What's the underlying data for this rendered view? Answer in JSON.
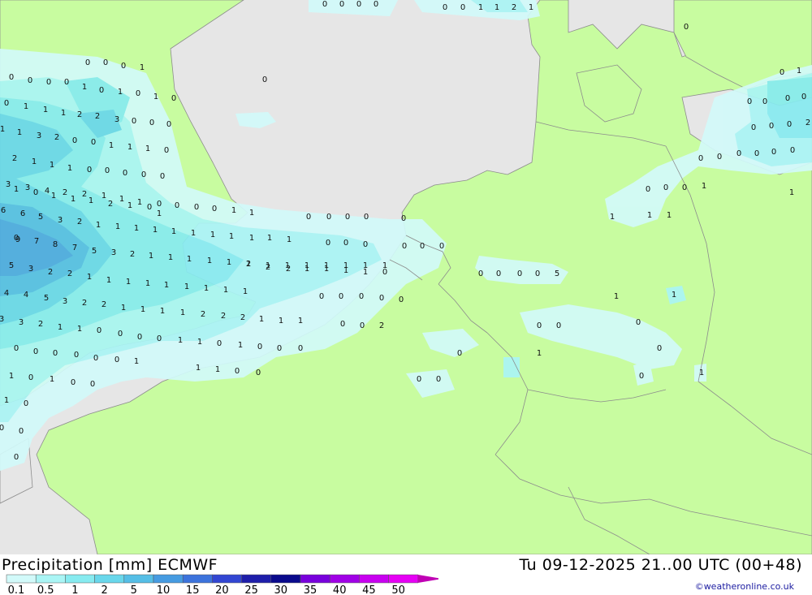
{
  "map": {
    "colors": {
      "sea": "#e6e6e6",
      "land": "#c8fca0",
      "border": "#8c8c8c"
    },
    "values": [
      {
        "t": "0"
      },
      {
        "t": "0"
      },
      {
        "t": "0"
      },
      {
        "t": "0"
      },
      {
        "t": "0"
      },
      {
        "t": "0"
      },
      {
        "t": "1"
      },
      {
        "t": "1"
      },
      {
        "t": "2"
      },
      {
        "t": "1"
      },
      {
        "t": "0"
      },
      {
        "t": "0"
      },
      {
        "t": "0"
      },
      {
        "t": "0"
      },
      {
        "t": "1"
      },
      {
        "t": "0"
      },
      {
        "t": "0"
      },
      {
        "t": "0"
      },
      {
        "t": "0"
      },
      {
        "t": "0"
      },
      {
        "t": "1"
      },
      {
        "t": "0"
      },
      {
        "t": "1"
      },
      {
        "t": "0"
      },
      {
        "t": "1"
      },
      {
        "t": "0"
      },
      {
        "t": "0"
      },
      {
        "t": "1"
      },
      {
        "t": "1"
      },
      {
        "t": "1"
      },
      {
        "t": "2"
      },
      {
        "t": "2"
      },
      {
        "t": "3"
      },
      {
        "t": "0"
      },
      {
        "t": "0"
      },
      {
        "t": "0"
      },
      {
        "t": "1"
      },
      {
        "t": "1"
      },
      {
        "t": "3"
      },
      {
        "t": "2"
      },
      {
        "t": "0"
      },
      {
        "t": "0"
      },
      {
        "t": "1"
      },
      {
        "t": "1"
      },
      {
        "t": "1"
      },
      {
        "t": "0"
      },
      {
        "t": "2"
      },
      {
        "t": "1"
      },
      {
        "t": "1"
      },
      {
        "t": "1"
      },
      {
        "t": "0"
      },
      {
        "t": "0"
      },
      {
        "t": "0"
      },
      {
        "t": "0"
      },
      {
        "t": "0"
      },
      {
        "t": "3"
      },
      {
        "t": "3"
      },
      {
        "t": "4"
      },
      {
        "t": "2"
      },
      {
        "t": "2"
      },
      {
        "t": "1"
      },
      {
        "t": "1"
      },
      {
        "t": "1"
      },
      {
        "t": "0"
      },
      {
        "t": "0"
      },
      {
        "t": "0"
      },
      {
        "t": "0"
      },
      {
        "t": "1"
      },
      {
        "t": "1"
      },
      {
        "t": "1"
      },
      {
        "t": "6"
      },
      {
        "t": "6"
      },
      {
        "t": "5"
      },
      {
        "t": "3"
      },
      {
        "t": "2"
      },
      {
        "t": "1"
      },
      {
        "t": "1"
      },
      {
        "t": "1"
      },
      {
        "t": "1"
      },
      {
        "t": "1"
      },
      {
        "t": "1"
      },
      {
        "t": "1"
      },
      {
        "t": "1"
      },
      {
        "t": "1"
      },
      {
        "t": "1"
      },
      {
        "t": "1"
      },
      {
        "t": "0"
      },
      {
        "t": "0"
      },
      {
        "t": "0"
      },
      {
        "t": "0"
      },
      {
        "t": "0"
      },
      {
        "t": "0"
      },
      {
        "t": "9"
      },
      {
        "t": "7"
      },
      {
        "t": "8"
      },
      {
        "t": "7"
      },
      {
        "t": "5"
      },
      {
        "t": "3"
      },
      {
        "t": "2"
      },
      {
        "t": "1"
      },
      {
        "t": "1"
      },
      {
        "t": "1"
      },
      {
        "t": "1"
      },
      {
        "t": "1"
      },
      {
        "t": "1"
      },
      {
        "t": "1"
      },
      {
        "t": "1"
      },
      {
        "t": "1"
      },
      {
        "t": "1"
      },
      {
        "t": "1"
      },
      {
        "t": "1"
      },
      {
        "t": "1"
      },
      {
        "t": "0"
      },
      {
        "t": "0"
      },
      {
        "t": "0"
      },
      {
        "t": "0"
      },
      {
        "t": "0"
      },
      {
        "t": "0"
      },
      {
        "t": "5"
      },
      {
        "t": "3"
      },
      {
        "t": "2"
      },
      {
        "t": "2"
      },
      {
        "t": "1"
      },
      {
        "t": "1"
      },
      {
        "t": "1"
      },
      {
        "t": "1"
      },
      {
        "t": "1"
      },
      {
        "t": "1"
      },
      {
        "t": "1"
      },
      {
        "t": "1"
      },
      {
        "t": "1"
      },
      {
        "t": "2"
      },
      {
        "t": "2"
      },
      {
        "t": "2"
      },
      {
        "t": "1"
      },
      {
        "t": "1"
      },
      {
        "t": "1"
      },
      {
        "t": "1"
      },
      {
        "t": "0"
      },
      {
        "t": "0"
      },
      {
        "t": "0"
      },
      {
        "t": "4"
      },
      {
        "t": "4"
      },
      {
        "t": "5"
      },
      {
        "t": "3"
      },
      {
        "t": "2"
      },
      {
        "t": "2"
      },
      {
        "t": "1"
      },
      {
        "t": "1"
      },
      {
        "t": "1"
      },
      {
        "t": "1"
      },
      {
        "t": "2"
      },
      {
        "t": "2"
      },
      {
        "t": "2"
      },
      {
        "t": "1"
      },
      {
        "t": "1"
      },
      {
        "t": "1"
      },
      {
        "t": "0"
      },
      {
        "t": "0"
      },
      {
        "t": "0"
      },
      {
        "t": "0"
      },
      {
        "t": "0"
      },
      {
        "t": "0"
      },
      {
        "t": "0"
      },
      {
        "t": "5"
      },
      {
        "t": "3"
      },
      {
        "t": "3"
      },
      {
        "t": "2"
      },
      {
        "t": "1"
      },
      {
        "t": "1"
      },
      {
        "t": "0"
      },
      {
        "t": "0"
      },
      {
        "t": "0"
      },
      {
        "t": "0"
      },
      {
        "t": "1"
      },
      {
        "t": "1"
      },
      {
        "t": "0"
      },
      {
        "t": "1"
      },
      {
        "t": "0"
      },
      {
        "t": "0"
      },
      {
        "t": "0"
      },
      {
        "t": "0"
      },
      {
        "t": "0"
      },
      {
        "t": "2"
      },
      {
        "t": "1"
      },
      {
        "t": "1"
      },
      {
        "t": "0"
      },
      {
        "t": "0"
      },
      {
        "t": "0"
      },
      {
        "t": "0"
      },
      {
        "t": "0"
      },
      {
        "t": "0"
      },
      {
        "t": "1"
      },
      {
        "t": "1"
      },
      {
        "t": "1"
      },
      {
        "t": "0"
      },
      {
        "t": "0"
      },
      {
        "t": "0"
      },
      {
        "t": "0"
      },
      {
        "t": "0"
      },
      {
        "t": "0"
      },
      {
        "t": "0"
      },
      {
        "t": "1"
      },
      {
        "t": "1"
      },
      {
        "t": "0"
      },
      {
        "t": "1"
      },
      {
        "t": "0"
      },
      {
        "t": "0"
      },
      {
        "t": "0"
      },
      {
        "t": "0"
      },
      {
        "t": "0"
      },
      {
        "t": "1"
      },
      {
        "t": "1"
      },
      {
        "t": "0"
      },
      {
        "t": "0"
      },
      {
        "t": "0"
      },
      {
        "t": "0"
      },
      {
        "t": "1"
      },
      {
        "t": "0"
      },
      {
        "t": "0"
      },
      {
        "t": "0"
      },
      {
        "t": "0"
      },
      {
        "t": "0"
      },
      {
        "t": "0"
      },
      {
        "t": "0"
      },
      {
        "t": "0"
      },
      {
        "t": "2"
      },
      {
        "t": "0"
      },
      {
        "t": "0"
      },
      {
        "t": "0"
      },
      {
        "t": "0"
      },
      {
        "t": "0"
      },
      {
        "t": "0"
      },
      {
        "t": "0"
      },
      {
        "t": "0"
      },
      {
        "t": "0"
      },
      {
        "t": "1"
      },
      {
        "t": "1"
      },
      {
        "t": "1"
      },
      {
        "t": "1"
      },
      {
        "t": "1"
      },
      {
        "t": "1"
      },
      {
        "t": "0"
      },
      {
        "t": "1"
      },
      {
        "t": "1"
      },
      {
        "t": "1"
      },
      {
        "t": "2"
      },
      {
        "t": "1"
      },
      {
        "t": "0"
      },
      {
        "t": "2"
      },
      {
        "t": "1"
      },
      {
        "t": "1"
      },
      {
        "t": "0"
      },
      {
        "t": "1"
      },
      {
        "t": "0"
      },
      {
        "t": "1"
      },
      {
        "t": "0"
      },
      {
        "t": "0"
      },
      {
        "t": "0"
      },
      {
        "t": "0"
      },
      {
        "t": "0"
      },
      {
        "t": "0"
      },
      {
        "t": "0"
      },
      {
        "t": "0"
      },
      {
        "t": "0"
      },
      {
        "t": "0"
      },
      {
        "t": "0"
      },
      {
        "t": "0"
      }
    ]
  },
  "footer": {
    "title": "Precipitation [mm] ECMWF",
    "datetime": "Tu 09-12-2025 21..00 UTC (00+48)",
    "credit": "©weatheronline.co.uk"
  },
  "legend": {
    "labels": [
      "0.1",
      "0.5",
      "1",
      "2",
      "5",
      "10",
      "15",
      "20",
      "25",
      "30",
      "35",
      "40",
      "45",
      "50"
    ],
    "colors": [
      "#d2fafa",
      "#aaf5f5",
      "#87ebf0",
      "#69d7eb",
      "#55bee6",
      "#469be1",
      "#3c73dc",
      "#3246d2",
      "#1e1eaa",
      "#0a0a8c",
      "#7800dc",
      "#a000e6",
      "#c800f0",
      "#e600f5",
      "#c000b4"
    ]
  }
}
